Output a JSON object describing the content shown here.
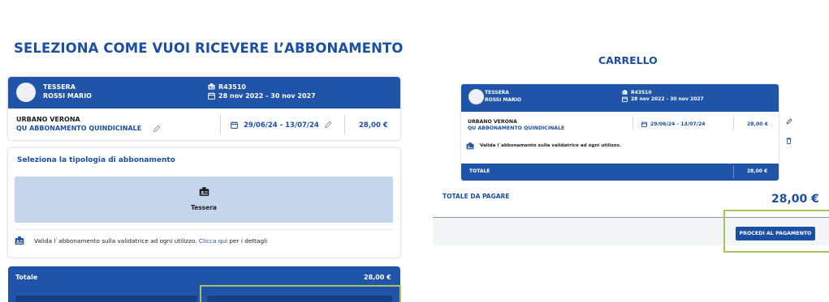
{
  "left": {
    "title": "SELEZIONA COME VUOI RICEVERE L’ABBONAMENTO",
    "card": {
      "type": "TESSERA",
      "holder": "ROSSI MARIO",
      "code": "R43510",
      "validity": "28 nov 2022 - 30 nov 2027",
      "product_line1": "URBANO VERONA",
      "product_line2": "QU ABBONAMENTO QUINDICINALE",
      "period": "29/06/24 - 13/07/24",
      "price": "28,00 €"
    },
    "tipologia": {
      "heading": "Seleziona la tipologia di abbonamento",
      "option_label": "Tessera",
      "note_prefix": "Valida l`abbonamento sulla validatrice ad ogni utilizzo. ",
      "note_link": "Clicca qui",
      "note_suffix": " per i dettagli"
    },
    "total_label": "Totale",
    "total_value": "28,00 €"
  },
  "right": {
    "title": "CARRELLO",
    "card": {
      "type": "TESSERA",
      "holder": "ROSSI MARIO",
      "code": "R43510",
      "validity": "28 nov 2022 - 30 nov 2027",
      "product_line1": "URBANO VERONA",
      "product_line2": "QU ABBONAMENTO QUINDICINALE",
      "period": "29/06/24 - 13/07/24",
      "price": "28,00 €",
      "note": "Valida l`abbonamento sulla validatrice ad ogni utilizzo.",
      "total_label": "TOTALE",
      "total_value": "28,00 €"
    },
    "pay_label": "TOTALE DA PAGARE",
    "pay_amount": "28,00 €",
    "pay_button": "PROCEDI AL PAGAMENTO"
  },
  "colors": {
    "brand_blue": "#1f54a8",
    "title_blue": "#1b4fa3",
    "tile_blue": "#c5d5eb",
    "highlight_green": "#a8c35b"
  },
  "icons": {
    "card": "id-card-icon",
    "calendar": "calendar-icon",
    "edit": "pencil-icon",
    "delete": "trash-icon"
  }
}
